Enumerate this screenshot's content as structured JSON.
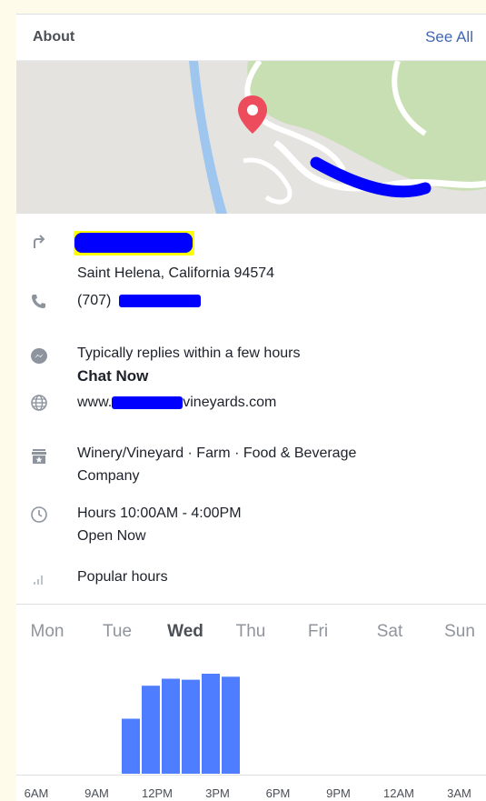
{
  "header": {
    "title": "About",
    "see_all": "See All"
  },
  "address": {
    "line2": "Saint Helena, California 94574"
  },
  "phone": {
    "prefix": "(707)"
  },
  "messenger": {
    "status": "Typically replies within a few hours",
    "action": "Chat Now"
  },
  "website": {
    "prefix": "www.",
    "suffix": "vineyards.com"
  },
  "category": {
    "line1": "Winery/Vineyard · Farm · Food & Beverage",
    "line2": "Company"
  },
  "hours": {
    "label": "Hours 10:00AM - 4:00PM",
    "status": "Open Now"
  },
  "popular": {
    "label": "Popular hours"
  },
  "days": [
    "Mon",
    "Tue",
    "Wed",
    "Thu",
    "Fri",
    "Sat",
    "Sun"
  ],
  "selected_day": "Wed",
  "chart_data": {
    "type": "bar",
    "x_tick_labels": [
      "6AM",
      "9AM",
      "12PM",
      "3PM",
      "6PM",
      "9PM",
      "12AM",
      "3AM"
    ],
    "categories": [
      "10AM",
      "11AM",
      "12PM",
      "1PM",
      "2PM",
      "3PM"
    ],
    "values": [
      55,
      88,
      95,
      94,
      100,
      97
    ],
    "ylim": [
      0,
      100
    ],
    "grid": false,
    "color": "#4e7eff"
  },
  "colors": {
    "accent": "#4267b2",
    "bar": "#4e7eff",
    "open": "#42b72a",
    "redaction": "#0000ff"
  }
}
